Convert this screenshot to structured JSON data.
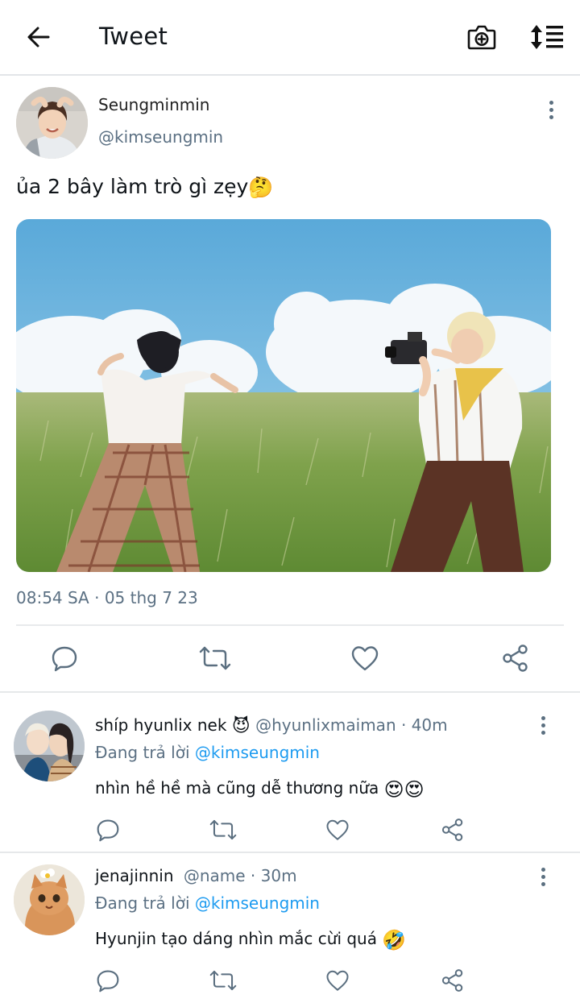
{
  "header": {
    "title": "Tweet",
    "back_icon": "arrow-left-icon",
    "camera_icon": "camera-plus-icon",
    "sort_icon": "sort-lines-icon"
  },
  "tweet": {
    "author_name": "Seungminmin",
    "author_handle": "@kimseungmin",
    "text": "ủa 2 bây làm trò gì zẹy",
    "text_emoji": "🤔",
    "timestamp": "08:54 SA · 05 thg 7 23",
    "actions": [
      "reply-icon",
      "retweet-icon",
      "like-icon",
      "share-icon"
    ]
  },
  "replies": [
    {
      "name": "shíp hyunlix nek",
      "name_emoji": "😈",
      "handle": "@hyunlixmaiman",
      "time": " · 40m",
      "reply_prefix": "Đang trả lời ",
      "reply_to": "@kimseungmin",
      "text": "nhìn hề hề mà cũng dễ thương nữa ",
      "text_emoji": "😍😍"
    },
    {
      "name": "jenajinnin",
      "name_emoji": "",
      "handle": "@name",
      "time": " · 30m",
      "reply_prefix": "Đang trả lời ",
      "reply_to": "@kimseungmin",
      "text": "Hyunjin tạo dáng nhìn mắc cừi quá ",
      "text_emoji": "🤣"
    }
  ],
  "colors": {
    "link": "#1d9bf0",
    "secondary_text": "#5b7083",
    "divider": "#e8eaec",
    "icon": "#5b6f80"
  }
}
